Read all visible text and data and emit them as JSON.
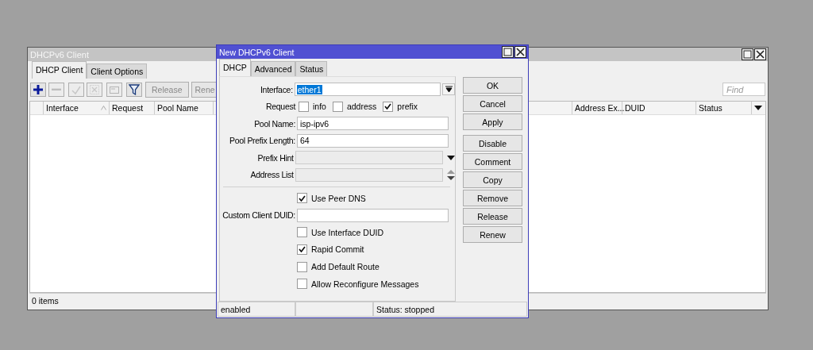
{
  "background_window": {
    "title": "DHCPv6 Client",
    "tabs": [
      {
        "label": "DHCP Client",
        "selected": true
      },
      {
        "label": "Client Options",
        "selected": false
      }
    ],
    "toolbar": {
      "icon_buttons": [
        {
          "kind": "add",
          "disabled": false
        },
        {
          "kind": "remove",
          "disabled": true
        },
        {
          "kind": "enable",
          "disabled": true
        },
        {
          "kind": "disable",
          "disabled": true
        },
        {
          "kind": "comment",
          "disabled": true
        },
        {
          "kind": "filter",
          "disabled": false
        }
      ],
      "text_buttons": [
        {
          "label": "Release",
          "disabled": true
        },
        {
          "label": "Rene",
          "disabled": true
        }
      ],
      "find": {
        "placeholder": "Find"
      }
    },
    "table": {
      "columns_left": [
        {
          "label": "Interface",
          "sorted": true
        },
        {
          "label": "Request",
          "sorted": false
        },
        {
          "label": "Pool Name",
          "sorted": false
        }
      ],
      "columns_right": [
        "Address Ex...",
        "DUID",
        "Status"
      ]
    },
    "status_bar": "0 items"
  },
  "dialog": {
    "title": "New DHCPv6 Client",
    "tabs": [
      {
        "label": "DHCP",
        "selected": true
      },
      {
        "label": "Advanced",
        "selected": false
      },
      {
        "label": "Status",
        "selected": false
      }
    ],
    "fields": [
      {
        "kind": "select",
        "label": "Interface:",
        "value": "ether1",
        "text_selected": true
      },
      {
        "kind": "checks",
        "label": "Request",
        "options": [
          {
            "label": "info",
            "checked": false
          },
          {
            "label": "address",
            "checked": false
          },
          {
            "label": "prefix",
            "checked": true
          }
        ]
      },
      {
        "kind": "text",
        "label": "Pool Name:",
        "value": "isp-ipv6"
      },
      {
        "kind": "text",
        "label": "Pool Prefix Length:",
        "value": "64"
      },
      {
        "kind": "dropdown",
        "label": "Prefix Hint"
      },
      {
        "kind": "updown",
        "label": "Address List"
      },
      {
        "kind": "separator"
      },
      {
        "kind": "checkbox",
        "label": "Use Peer DNS",
        "checked": true
      },
      {
        "kind": "text",
        "label": "Custom Client DUID:"
      },
      {
        "kind": "checkbox",
        "label": "Use Interface DUID",
        "checked": false
      },
      {
        "kind": "checkbox",
        "label": "Rapid Commit",
        "checked": true
      },
      {
        "kind": "checkbox",
        "label": "Add Default Route",
        "checked": false
      },
      {
        "kind": "checkbox",
        "label": "Allow Reconfigure Messages",
        "checked": false
      }
    ],
    "buttons": [
      [
        "OK",
        "Cancel",
        "Apply"
      ],
      [
        "Disable",
        "Comment",
        "Copy",
        "Remove",
        "Release",
        "Renew"
      ]
    ],
    "status_bar": {
      "left": "enabled",
      "right": "Status: stopped"
    }
  }
}
